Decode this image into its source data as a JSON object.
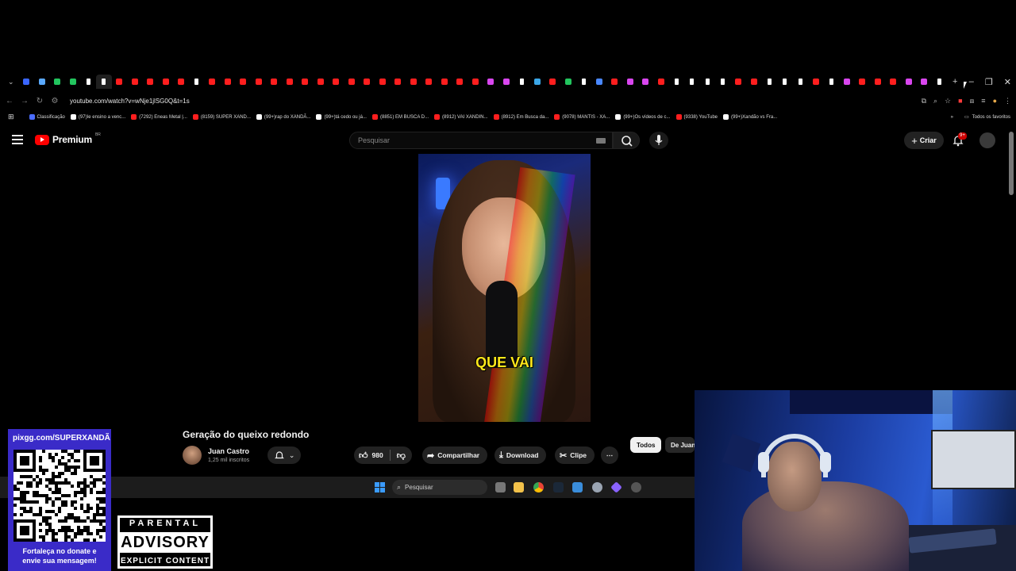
{
  "browser": {
    "url": "youtube.com/watch?v=wNje1jlSG0Q&t=1s",
    "tab_favicon_colors": [
      "#3a66ff",
      "#5aa9ff",
      "#22c55e",
      "#22c55e",
      "#ffffff",
      "#ffffff",
      "#ff1e1e",
      "#ff1e1e",
      "#ff1e1e",
      "#ff1e1e",
      "#ff1e1e",
      "#ffffff",
      "#ff1e1e",
      "#ff1e1e",
      "#ff1e1e",
      "#ff1e1e",
      "#ff1e1e",
      "#ff1e1e",
      "#ff1e1e",
      "#ff1e1e",
      "#ff1e1e",
      "#ff1e1e",
      "#ff1e1e",
      "#ff1e1e",
      "#ff1e1e",
      "#ff1e1e",
      "#ff1e1e",
      "#ff1e1e",
      "#ff1e1e",
      "#ff1e1e",
      "#d946ef",
      "#d946ef",
      "#ffffff",
      "#3ba7e8",
      "#ff1e1e",
      "#22c55e",
      "#ffffff",
      "#4a88ff",
      "#ff1e1e",
      "#d946ef",
      "#d946ef",
      "#ff1e1e",
      "#ffffff",
      "#ffffff",
      "#ffffff",
      "#ffffff",
      "#ff1e1e",
      "#ff1e1e",
      "#ffffff",
      "#ffffff",
      "#ffffff",
      "#ff1e1e",
      "#ffffff",
      "#d946ef",
      "#ff1e1e",
      "#ff1e1e",
      "#ff1e1e",
      "#d946ef",
      "#d946ef",
      "#ffffff"
    ],
    "bookmarks": [
      {
        "label": "Classificação",
        "color": "#4a6cff"
      },
      {
        "label": "(97)Ie ensino a venc...",
        "color": "#ffffff"
      },
      {
        "label": "(7292) Eneas Metal |...",
        "color": "#ff1e1e"
      },
      {
        "label": "(8159) SUPER XAND...",
        "color": "#ff1e1e"
      },
      {
        "label": "(99+)rap do XANDÃ...",
        "color": "#ffffff"
      },
      {
        "label": "(99+)tá cedo ou já...",
        "color": "#ffffff"
      },
      {
        "label": "(8851) EM BUSCA D...",
        "color": "#ff1e1e"
      },
      {
        "label": "(8912) VAI XANDIN...",
        "color": "#ff1e1e"
      },
      {
        "label": "(8912) Em Busca da...",
        "color": "#ff1e1e"
      },
      {
        "label": "(9078) MANTIS - XA...",
        "color": "#ff1e1e"
      },
      {
        "label": "(99+)Os vídeos de c...",
        "color": "#ffffff"
      },
      {
        "label": "(9338) YouTube",
        "color": "#ff1e1e"
      },
      {
        "label": "(99+)Xandão vs Fra...",
        "color": "#ffffff"
      }
    ],
    "all_favorites": "Todos os favoritos"
  },
  "youtube": {
    "logo_text": "Premium",
    "country": "BR",
    "search_placeholder": "Pesquisar",
    "create_label": "Criar",
    "notification_count": "9+",
    "video_caption": "QUE VAI",
    "video_title": "Geração do queixo redondo",
    "channel_name": "Juan Castro",
    "channel_subs": "1,25 mil inscritos",
    "likes": "980",
    "share_label": "Compartilhar",
    "download_label": "Download",
    "clip_label": "Clipe",
    "chip_all": "Todos",
    "chip_from": "De Juan"
  },
  "taskbar": {
    "search_placeholder": "Pesquisar"
  },
  "overlay": {
    "qr_url": "pixgg.com/SUPERXANDÃ",
    "qr_message_line1": "Fortaleça no donate e",
    "qr_message_line2": "envie sua mensagem!",
    "advisory_top": "PARENTAL",
    "advisory_mid": "ADVISORY",
    "advisory_bot": "EXPLICIT CONTENT"
  },
  "colors": {
    "accent_red": "#ff0000",
    "qr_card": "#3a2bc8"
  }
}
